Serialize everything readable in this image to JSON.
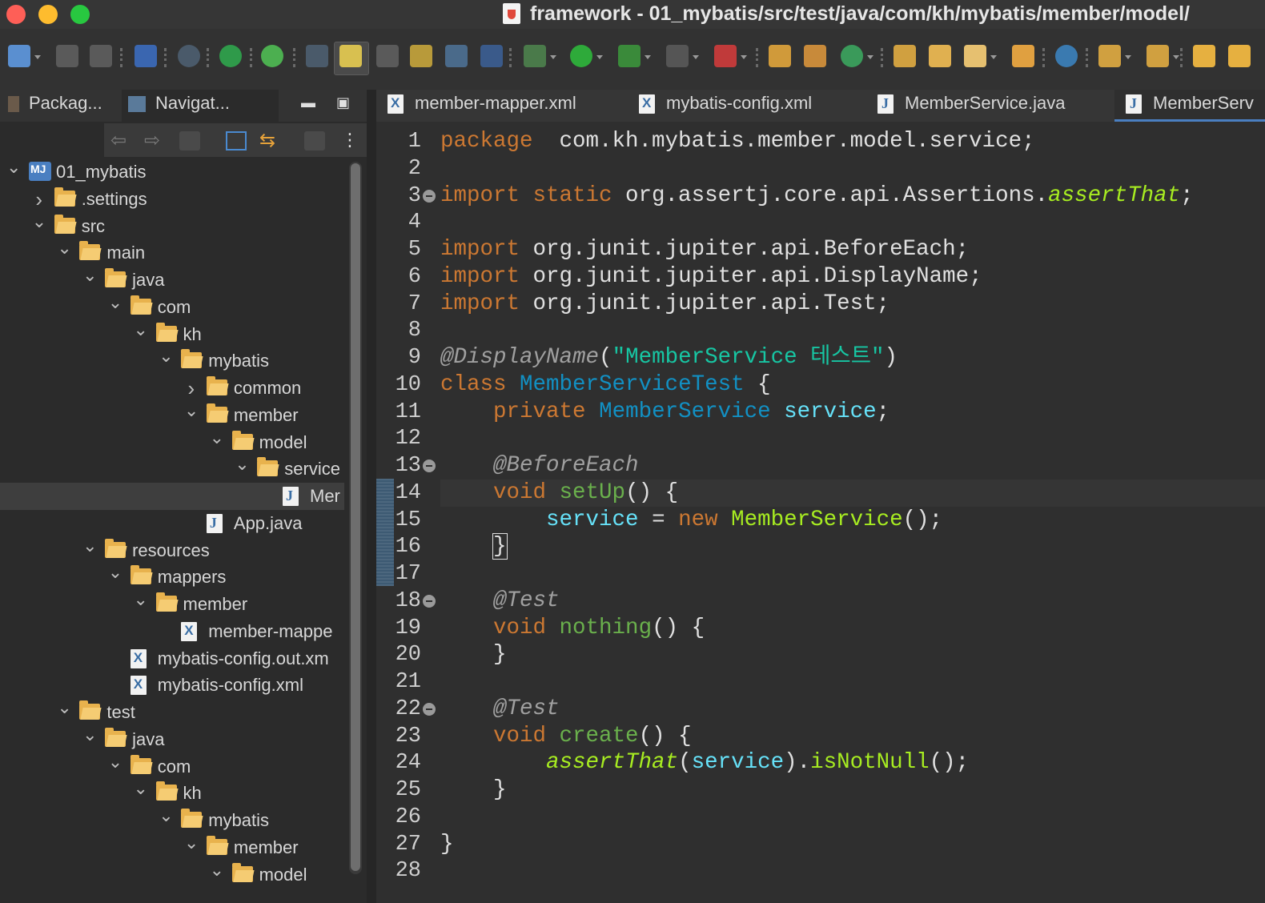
{
  "window": {
    "title": "framework - 01_mybatis/src/test/java/com/kh/mybatis/member/model/"
  },
  "left_panel": {
    "tabs": [
      {
        "label": "Packag..."
      },
      {
        "label": "Navigat..."
      }
    ],
    "tree": [
      {
        "label": "01_mybatis",
        "level": 0,
        "expanded": true,
        "type": "project"
      },
      {
        "label": ".settings",
        "level": 1,
        "expanded": false,
        "type": "folder"
      },
      {
        "label": "src",
        "level": 1,
        "expanded": true,
        "type": "folder"
      },
      {
        "label": "main",
        "level": 2,
        "expanded": true,
        "type": "folder"
      },
      {
        "label": "java",
        "level": 3,
        "expanded": true,
        "type": "folder"
      },
      {
        "label": "com",
        "level": 4,
        "expanded": true,
        "type": "folder"
      },
      {
        "label": "kh",
        "level": 5,
        "expanded": true,
        "type": "folder"
      },
      {
        "label": "mybatis",
        "level": 6,
        "expanded": true,
        "type": "folder"
      },
      {
        "label": "common",
        "level": 7,
        "expanded": false,
        "type": "folder"
      },
      {
        "label": "member",
        "level": 7,
        "expanded": true,
        "type": "folder"
      },
      {
        "label": "model",
        "level": 8,
        "expanded": true,
        "type": "folder"
      },
      {
        "label": "service",
        "level": 9,
        "expanded": true,
        "type": "folder"
      },
      {
        "label": "Mer",
        "level": 10,
        "type": "java",
        "selected": true
      },
      {
        "label": "App.java",
        "level": 7,
        "type": "java"
      },
      {
        "label": "resources",
        "level": 3,
        "expanded": true,
        "type": "folder"
      },
      {
        "label": "mappers",
        "level": 4,
        "expanded": true,
        "type": "folder"
      },
      {
        "label": "member",
        "level": 5,
        "expanded": true,
        "type": "folder"
      },
      {
        "label": "member-mappe",
        "level": 6,
        "type": "xml"
      },
      {
        "label": "mybatis-config.out.xm",
        "level": 4,
        "type": "xml"
      },
      {
        "label": "mybatis-config.xml",
        "level": 4,
        "type": "xml"
      },
      {
        "label": "test",
        "level": 2,
        "expanded": true,
        "type": "folder"
      },
      {
        "label": "java",
        "level": 3,
        "expanded": true,
        "type": "folder"
      },
      {
        "label": "com",
        "level": 4,
        "expanded": true,
        "type": "folder"
      },
      {
        "label": "kh",
        "level": 5,
        "expanded": true,
        "type": "folder"
      },
      {
        "label": "mybatis",
        "level": 6,
        "expanded": true,
        "type": "folder"
      },
      {
        "label": "member",
        "level": 7,
        "expanded": true,
        "type": "folder"
      },
      {
        "label": "model",
        "level": 8,
        "expanded": true,
        "type": "folder"
      }
    ]
  },
  "editor": {
    "tabs": [
      {
        "label": "member-mapper.xml",
        "icon": "xml-file-icon"
      },
      {
        "label": "mybatis-config.xml",
        "icon": "xml-file-icon"
      },
      {
        "label": "MemberService.java",
        "icon": "java-file-icon"
      },
      {
        "label": "MemberServ",
        "icon": "java-file-icon",
        "active": true
      }
    ],
    "current_line": 14,
    "folded_lines": [
      3,
      13,
      18,
      22
    ],
    "lines": [
      [
        [
          "kw",
          "package"
        ],
        [
          "",
          "  com.kh.mybatis.member.model.service;"
        ]
      ],
      [],
      [
        [
          "kw",
          "import static"
        ],
        [
          "",
          " org.assertj.core.api.Assertions."
        ],
        [
          "ital",
          "assertThat"
        ],
        [
          "",
          ";"
        ]
      ],
      [],
      [
        [
          "kw",
          "import"
        ],
        [
          "",
          " org.junit.jupiter.api.BeforeEach;"
        ]
      ],
      [
        [
          "kw",
          "import"
        ],
        [
          "",
          " org.junit.jupiter.api.DisplayName;"
        ]
      ],
      [
        [
          "kw",
          "import"
        ],
        [
          "",
          " org.junit.jupiter.api.Test;"
        ]
      ],
      [],
      [
        [
          "ann",
          "@DisplayName"
        ],
        [
          "",
          "("
        ],
        [
          "str",
          "\"MemberService 테스트\""
        ],
        [
          "",
          ")"
        ]
      ],
      [
        [
          "kw",
          "class"
        ],
        [
          "",
          " "
        ],
        [
          "tp",
          "MemberServiceTest"
        ],
        [
          "",
          " {"
        ]
      ],
      [
        [
          "",
          "    "
        ],
        [
          "kw",
          "private"
        ],
        [
          "",
          " "
        ],
        [
          "tp",
          "MemberService"
        ],
        [
          "",
          " "
        ],
        [
          "fld",
          "service"
        ],
        [
          "",
          ";"
        ]
      ],
      [],
      [
        [
          "",
          "    "
        ],
        [
          "ann",
          "@BeforeEach"
        ]
      ],
      [
        [
          "",
          "    "
        ],
        [
          "kw",
          "void"
        ],
        [
          "",
          " "
        ],
        [
          "mdec",
          "setUp"
        ],
        [
          "",
          "() {"
        ]
      ],
      [
        [
          "",
          "        "
        ],
        [
          "fld",
          "service"
        ],
        [
          "",
          " = "
        ],
        [
          "kw",
          "new"
        ],
        [
          "",
          " "
        ],
        [
          "mth",
          "MemberService"
        ],
        [
          "",
          "();"
        ]
      ],
      [
        [
          "",
          "    "
        ],
        [
          "bracebox",
          "}"
        ]
      ],
      [],
      [
        [
          "",
          "    "
        ],
        [
          "ann",
          "@Test"
        ]
      ],
      [
        [
          "",
          "    "
        ],
        [
          "kw",
          "void"
        ],
        [
          "",
          " "
        ],
        [
          "mdec",
          "nothing"
        ],
        [
          "",
          "() {"
        ]
      ],
      [
        [
          "",
          "    }"
        ]
      ],
      [],
      [
        [
          "",
          "    "
        ],
        [
          "ann",
          "@Test"
        ]
      ],
      [
        [
          "",
          "    "
        ],
        [
          "kw",
          "void"
        ],
        [
          "",
          " "
        ],
        [
          "mdec",
          "create"
        ],
        [
          "",
          "() {"
        ]
      ],
      [
        [
          "",
          "        "
        ],
        [
          "ital",
          "assertThat"
        ],
        [
          "",
          "("
        ],
        [
          "fld",
          "service"
        ],
        [
          "",
          ")."
        ],
        [
          "mth",
          "isNotNull"
        ],
        [
          "",
          "();"
        ]
      ],
      [
        [
          "",
          "    }"
        ]
      ],
      [],
      [
        [
          "",
          "}"
        ]
      ],
      []
    ]
  }
}
